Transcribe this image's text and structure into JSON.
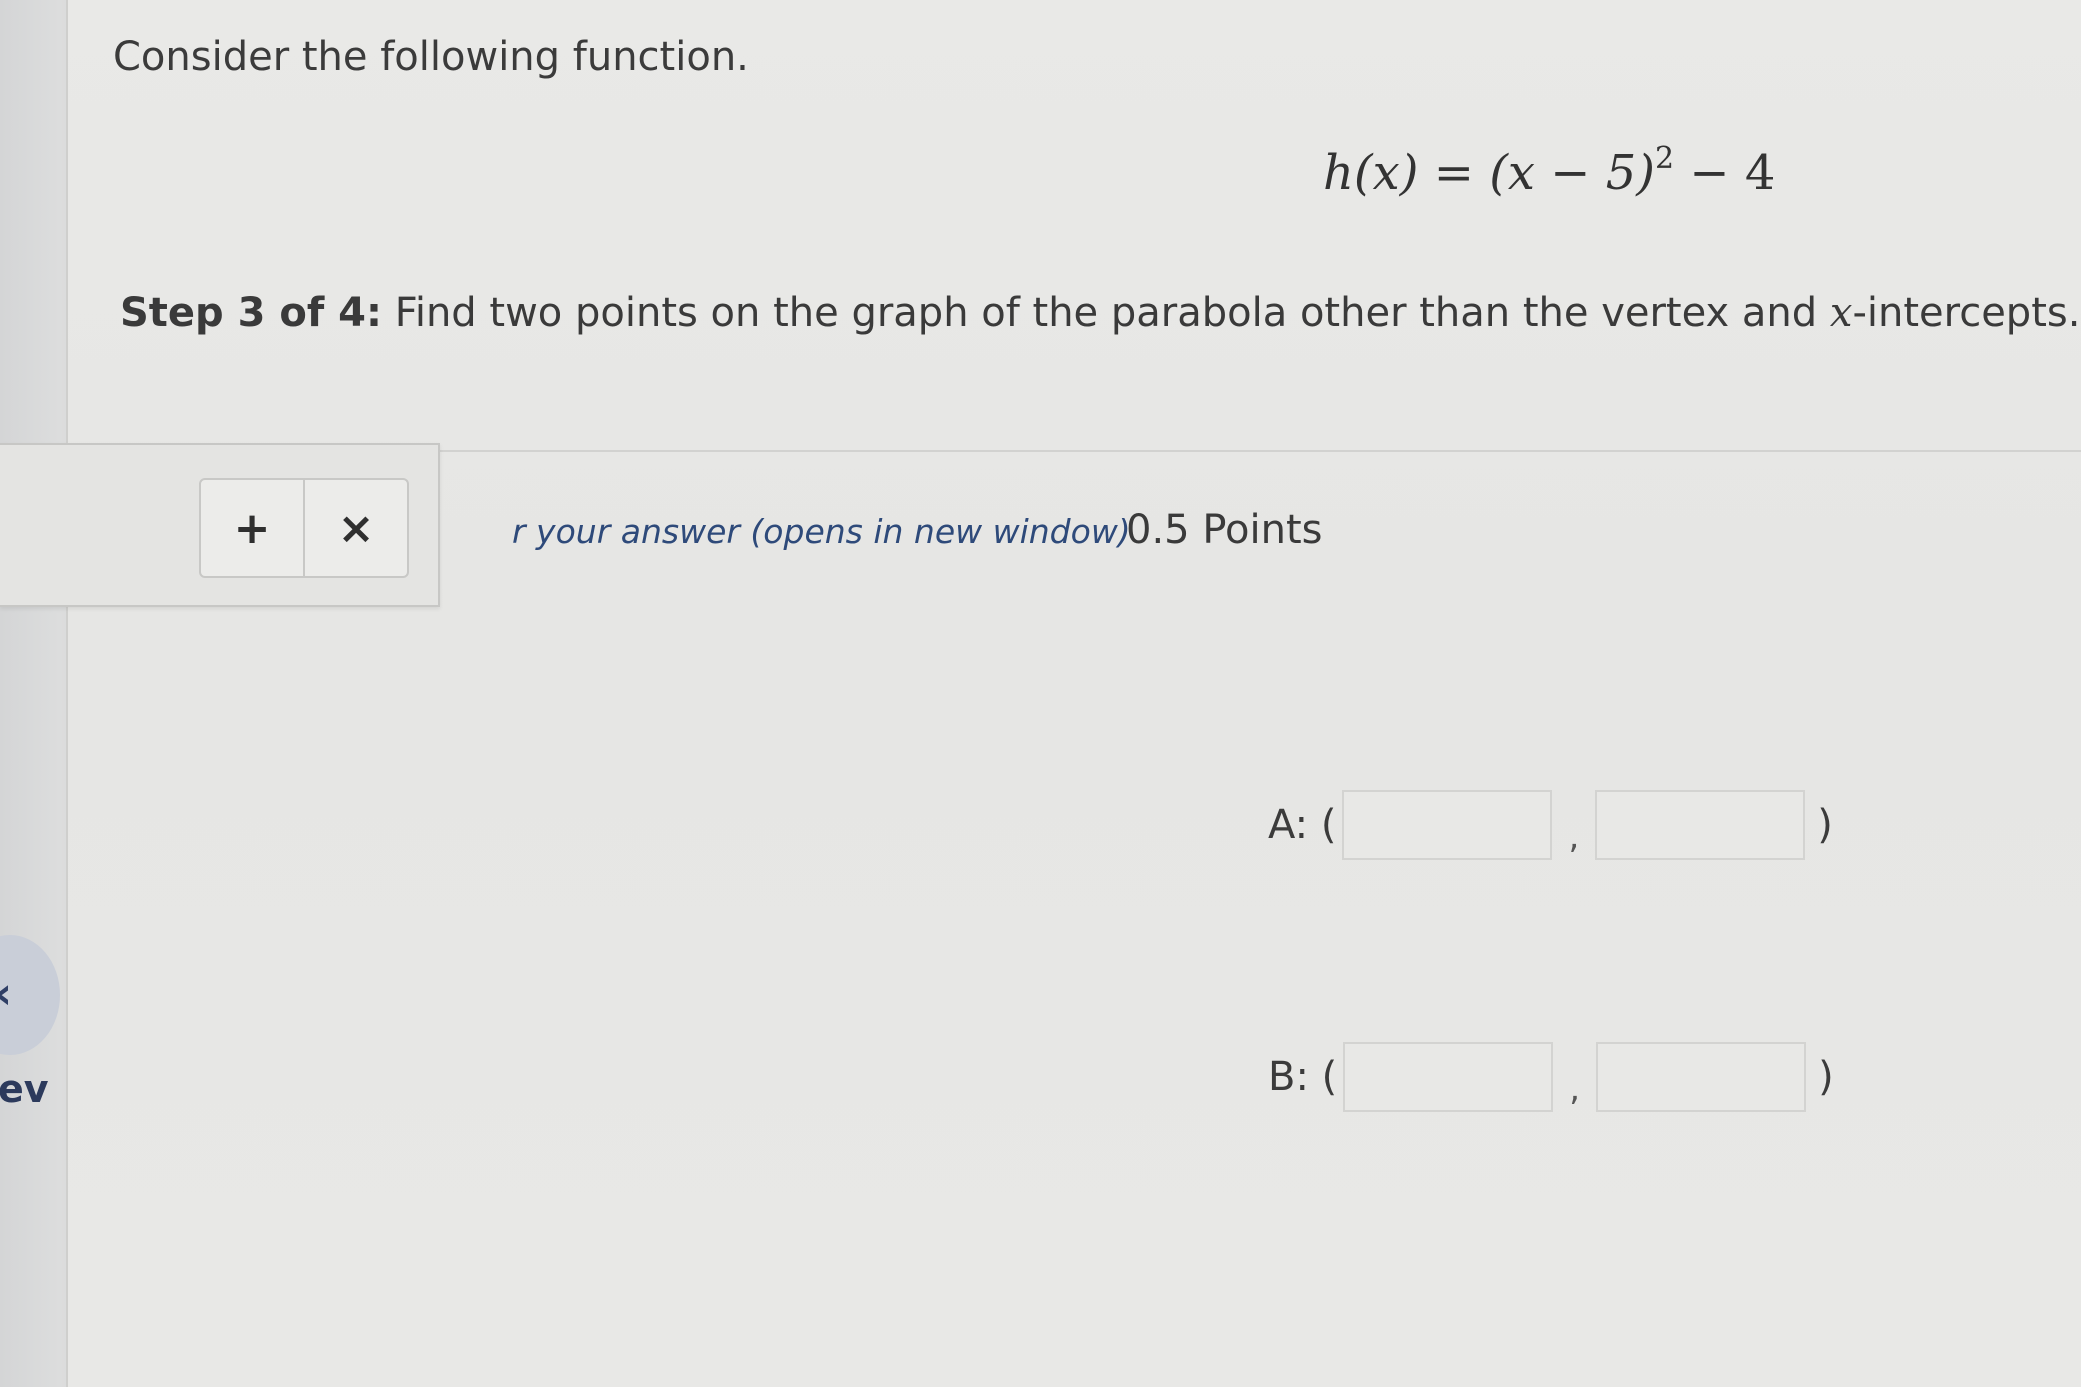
{
  "question": {
    "intro": "Consider the following function.",
    "formula": {
      "lhs": "h(x)",
      "rhs_main": "(x − 5)",
      "exponent": "2",
      "rhs_tail": " − 4"
    },
    "step_label": "Step 3 of 4:",
    "step_text_before": " Find two points on the graph of the parabola other than the vertex and ",
    "step_var": "x",
    "step_text_after": "-intercepts."
  },
  "toolbar": {
    "add_label": "+",
    "remove_label": "×"
  },
  "help_link": "r your answer (opens in new window)",
  "points": "0.5 Points",
  "answers": [
    {
      "label": "A: (",
      "x_value": "",
      "y_value": "",
      "comma": ",",
      "close": ")"
    },
    {
      "label": "B: (",
      "x_value": "",
      "y_value": "",
      "comma": ",",
      "close": ")"
    }
  ],
  "sidebar": {
    "prev_arrow": "‹",
    "prev_text": "ev"
  }
}
